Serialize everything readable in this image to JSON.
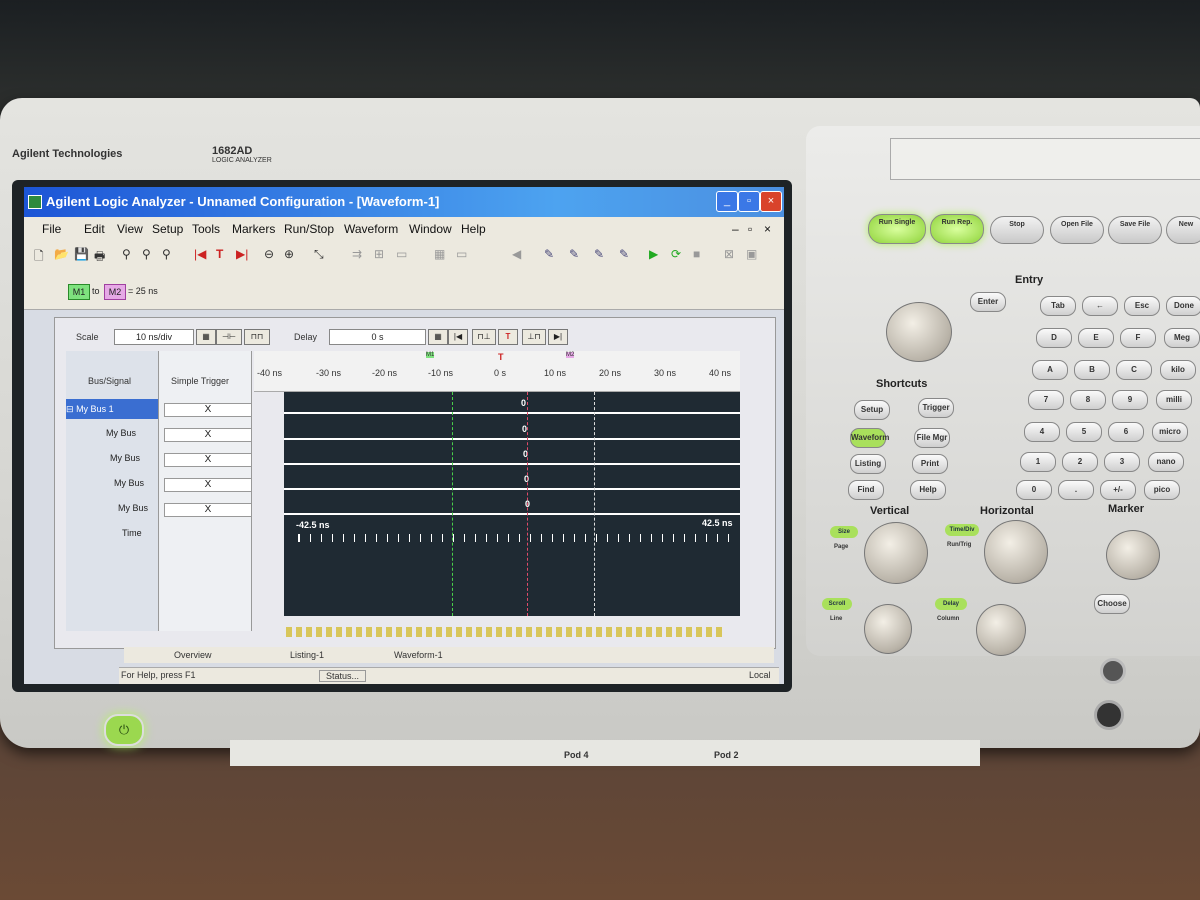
{
  "device": {
    "brand": "Agilent Technologies",
    "model": "1682AD",
    "model_sub": "LOGIC ANALYZER",
    "power_icon": "power-icon"
  },
  "window": {
    "title": "Agilent Logic Analyzer - Unnamed Configuration - [Waveform-1]",
    "controls": [
      "_",
      "▫",
      "×"
    ]
  },
  "menu": [
    "File",
    "Edit",
    "View",
    "Setup",
    "Tools",
    "Markers",
    "Run/Stop",
    "Waveform",
    "Window",
    "Help"
  ],
  "markers": {
    "m1": "M1",
    "to": "to",
    "m2": "M2",
    "delta": "= 25 ns"
  },
  "scale": {
    "label": "Scale",
    "value": "10 ns/div",
    "delay_label": "Delay",
    "delay_value": "0 s"
  },
  "columns": {
    "bus_signal": "Bus/Signal",
    "simple_trigger": "Simple Trigger"
  },
  "buses": [
    {
      "name": "My Bus 1",
      "trigger": "X",
      "value": "0"
    },
    {
      "name": "My Bus",
      "trigger": "X",
      "value": "0"
    },
    {
      "name": "My Bus",
      "trigger": "X",
      "value": "0"
    },
    {
      "name": "My Bus",
      "trigger": "X",
      "value": "0"
    },
    {
      "name": "My Bus",
      "trigger": "X",
      "value": "0"
    }
  ],
  "time_row": {
    "label": "Time",
    "left": "-42.5 ns",
    "right": "42.5 ns"
  },
  "ruler": {
    "ticks": [
      "-40 ns",
      "-30 ns",
      "-20 ns",
      "-10 ns",
      "0 s",
      "10 ns",
      "20 ns",
      "30 ns",
      "40 ns"
    ],
    "m1": "M1",
    "t": "T",
    "m2": "M2"
  },
  "tabs": [
    "Overview",
    "Listing-1",
    "Waveform-1"
  ],
  "status": {
    "help": "For Help, press F1",
    "status": "Status...",
    "local": "Local"
  },
  "panel": {
    "run_single": "Run Single",
    "run_rep": "Run Rep.",
    "stop": "Stop",
    "open_file": "Open File",
    "save_file": "Save File",
    "new": "New",
    "entry": "Entry",
    "enter": "Enter",
    "shortcuts": "Shortcuts",
    "shortcut_keys": [
      "Setup",
      "Trigger",
      "Waveform",
      "File Mgr",
      "Listing",
      "Print",
      "Find",
      "Help"
    ],
    "entry_keys": [
      "Tab",
      "←",
      "Esc",
      "Done",
      "D",
      "E",
      "F",
      "Meg",
      "A",
      "B",
      "C",
      "kilo",
      "7",
      "8",
      "9",
      "milli",
      "4",
      "5",
      "6",
      "micro",
      "1",
      "2",
      "3",
      "nano",
      "0",
      ".",
      "+/-",
      "pico"
    ],
    "vertical": "Vertical",
    "horizontal": "Horizontal",
    "marker": "Marker",
    "size": "Size",
    "page": "Page",
    "time_div": "Time/Div",
    "run_trig": "Run/Trig",
    "scroll": "Scroll",
    "line": "Line",
    "delay": "Delay",
    "column": "Column",
    "choose": "Choose"
  },
  "pods": [
    "Pod 4",
    "Pod 2"
  ]
}
